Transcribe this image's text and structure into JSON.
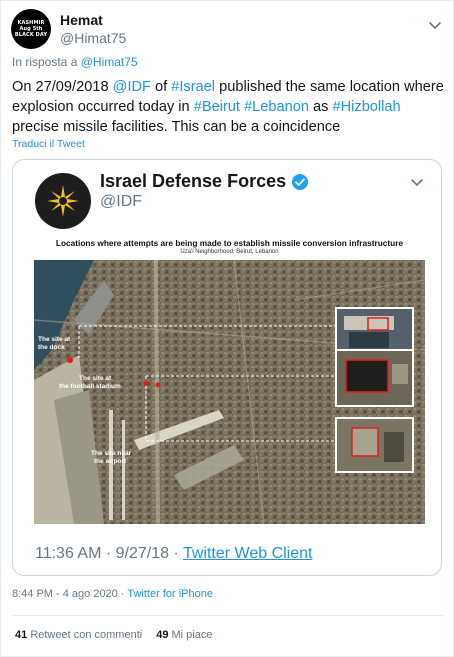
{
  "author": {
    "avatar_lines": [
      "KASHMIR",
      "Aug 5th",
      "BLACK DAY"
    ],
    "name": "Hemat",
    "handle": "@Himat75"
  },
  "reply": {
    "prefix": "In risposta a",
    "mention": "@Himat75"
  },
  "tweet": {
    "segments": [
      {
        "t": "On 27/09/2018 ",
        "link": false
      },
      {
        "t": "@IDF",
        "link": true
      },
      {
        "t": " of ",
        "link": false
      },
      {
        "t": "#Israel",
        "link": true
      },
      {
        "t": " published the same location where explosion occurred today in ",
        "link": false
      },
      {
        "t": "#Beirut",
        "link": true
      },
      {
        "t": " ",
        "link": false
      },
      {
        "t": "#Lebanon",
        "link": true
      },
      {
        "t": " as ",
        "link": false
      },
      {
        "t": "#Hizbollah",
        "link": true
      },
      {
        "t": " precise missile facilities. This can be a coincidence",
        "link": false
      }
    ],
    "translate_label": "Traduci il Tweet"
  },
  "quoted": {
    "name": "Israel Defense Forces",
    "handle": "@IDF",
    "image": {
      "title": "Locations where attempts are being made to establish missile conversion infrastructure",
      "subtitle": "Uza'i Neighborhood, Beirut, Lebanon",
      "labels": {
        "dock": [
          "The site at",
          "the dock"
        ],
        "stadium": [
          "The site at",
          "the football stadium"
        ],
        "airport": [
          "The site near",
          "the airport"
        ]
      }
    },
    "time": "11:36 AM · 9/27/18 · ",
    "client": "Twitter Web Client"
  },
  "meta": {
    "datetime": "8:44 PM - 4 ago 2020",
    "separator": " · ",
    "source": "Twitter for iPhone"
  },
  "stats": {
    "retweets_count": "41",
    "retweets_label": "Retweet con commenti",
    "likes_count": "49",
    "likes_label": "Mi piace"
  },
  "colors": {
    "link": "#1b95e0",
    "secondary": "#657786",
    "verified": "#1da1f2",
    "marker": "#e0201c"
  }
}
